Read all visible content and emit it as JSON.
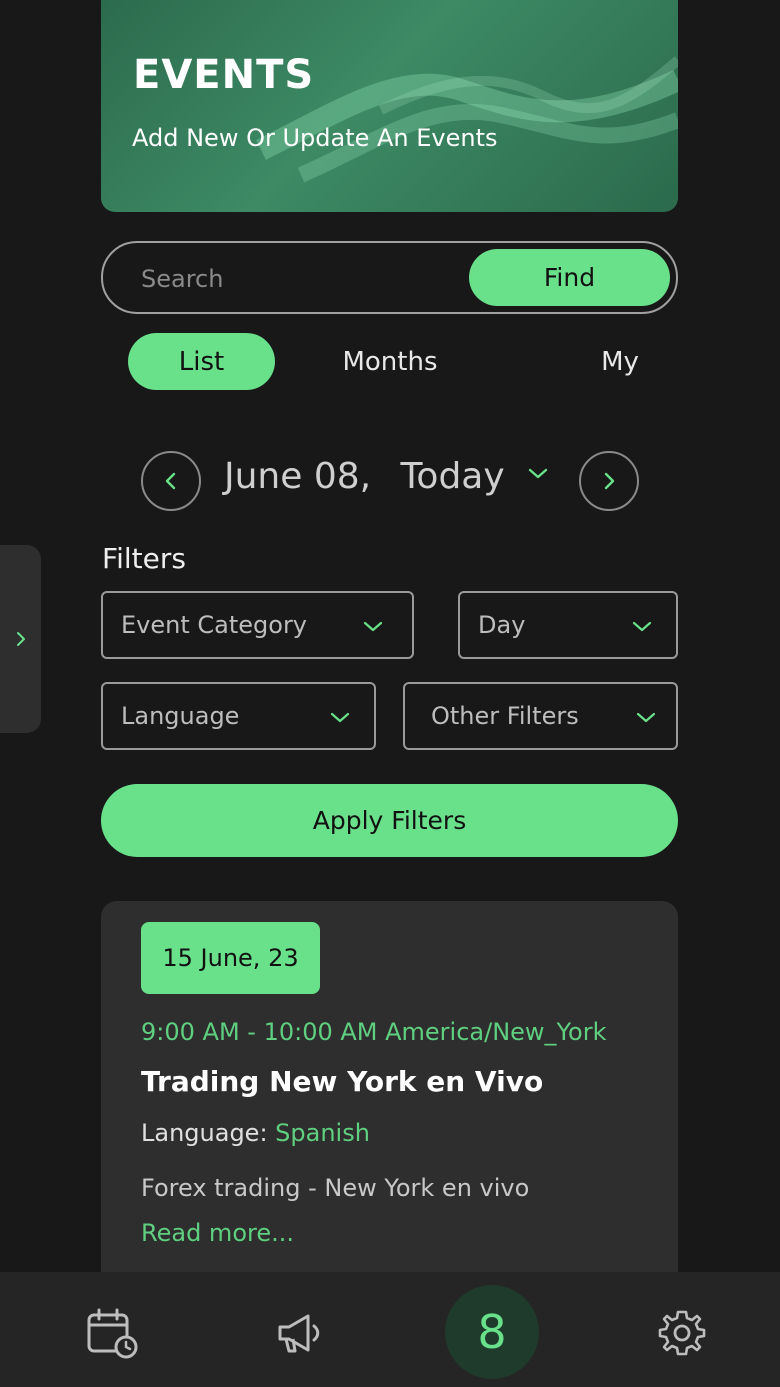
{
  "hero": {
    "title": "EVENTS",
    "subtitle": "Add New Or Update An Events"
  },
  "search": {
    "placeholder": "Search",
    "button_label": "Find"
  },
  "tabs": [
    {
      "label": "List",
      "active": true
    },
    {
      "label": "Months",
      "active": false
    },
    {
      "label": "My",
      "active": false
    }
  ],
  "date_nav": {
    "date": "June 08,",
    "today": "Today"
  },
  "filters": {
    "title": "Filters",
    "event_category": "Event Category",
    "day": "Day",
    "language": "Language",
    "other": "Other Filters",
    "apply_label": "Apply Filters"
  },
  "event": {
    "date_badge": "15 June, 23",
    "time": "9:00 AM - 10:00 AM America/New_York",
    "title": "Trading New York en Vivo",
    "language_label": "Language:",
    "language_value": "Spanish",
    "description": "Forex trading - New York en vivo",
    "read_more": "Read more..."
  },
  "bottom_nav": {
    "items": [
      "calendar-clock-icon",
      "megaphone-icon",
      "logo-8-icon",
      "gear-icon"
    ],
    "center_glyph": "8"
  },
  "colors": {
    "accent": "#69e08a",
    "background": "#181818",
    "card": "#2e2e2e",
    "hero": "#3d8a65"
  }
}
